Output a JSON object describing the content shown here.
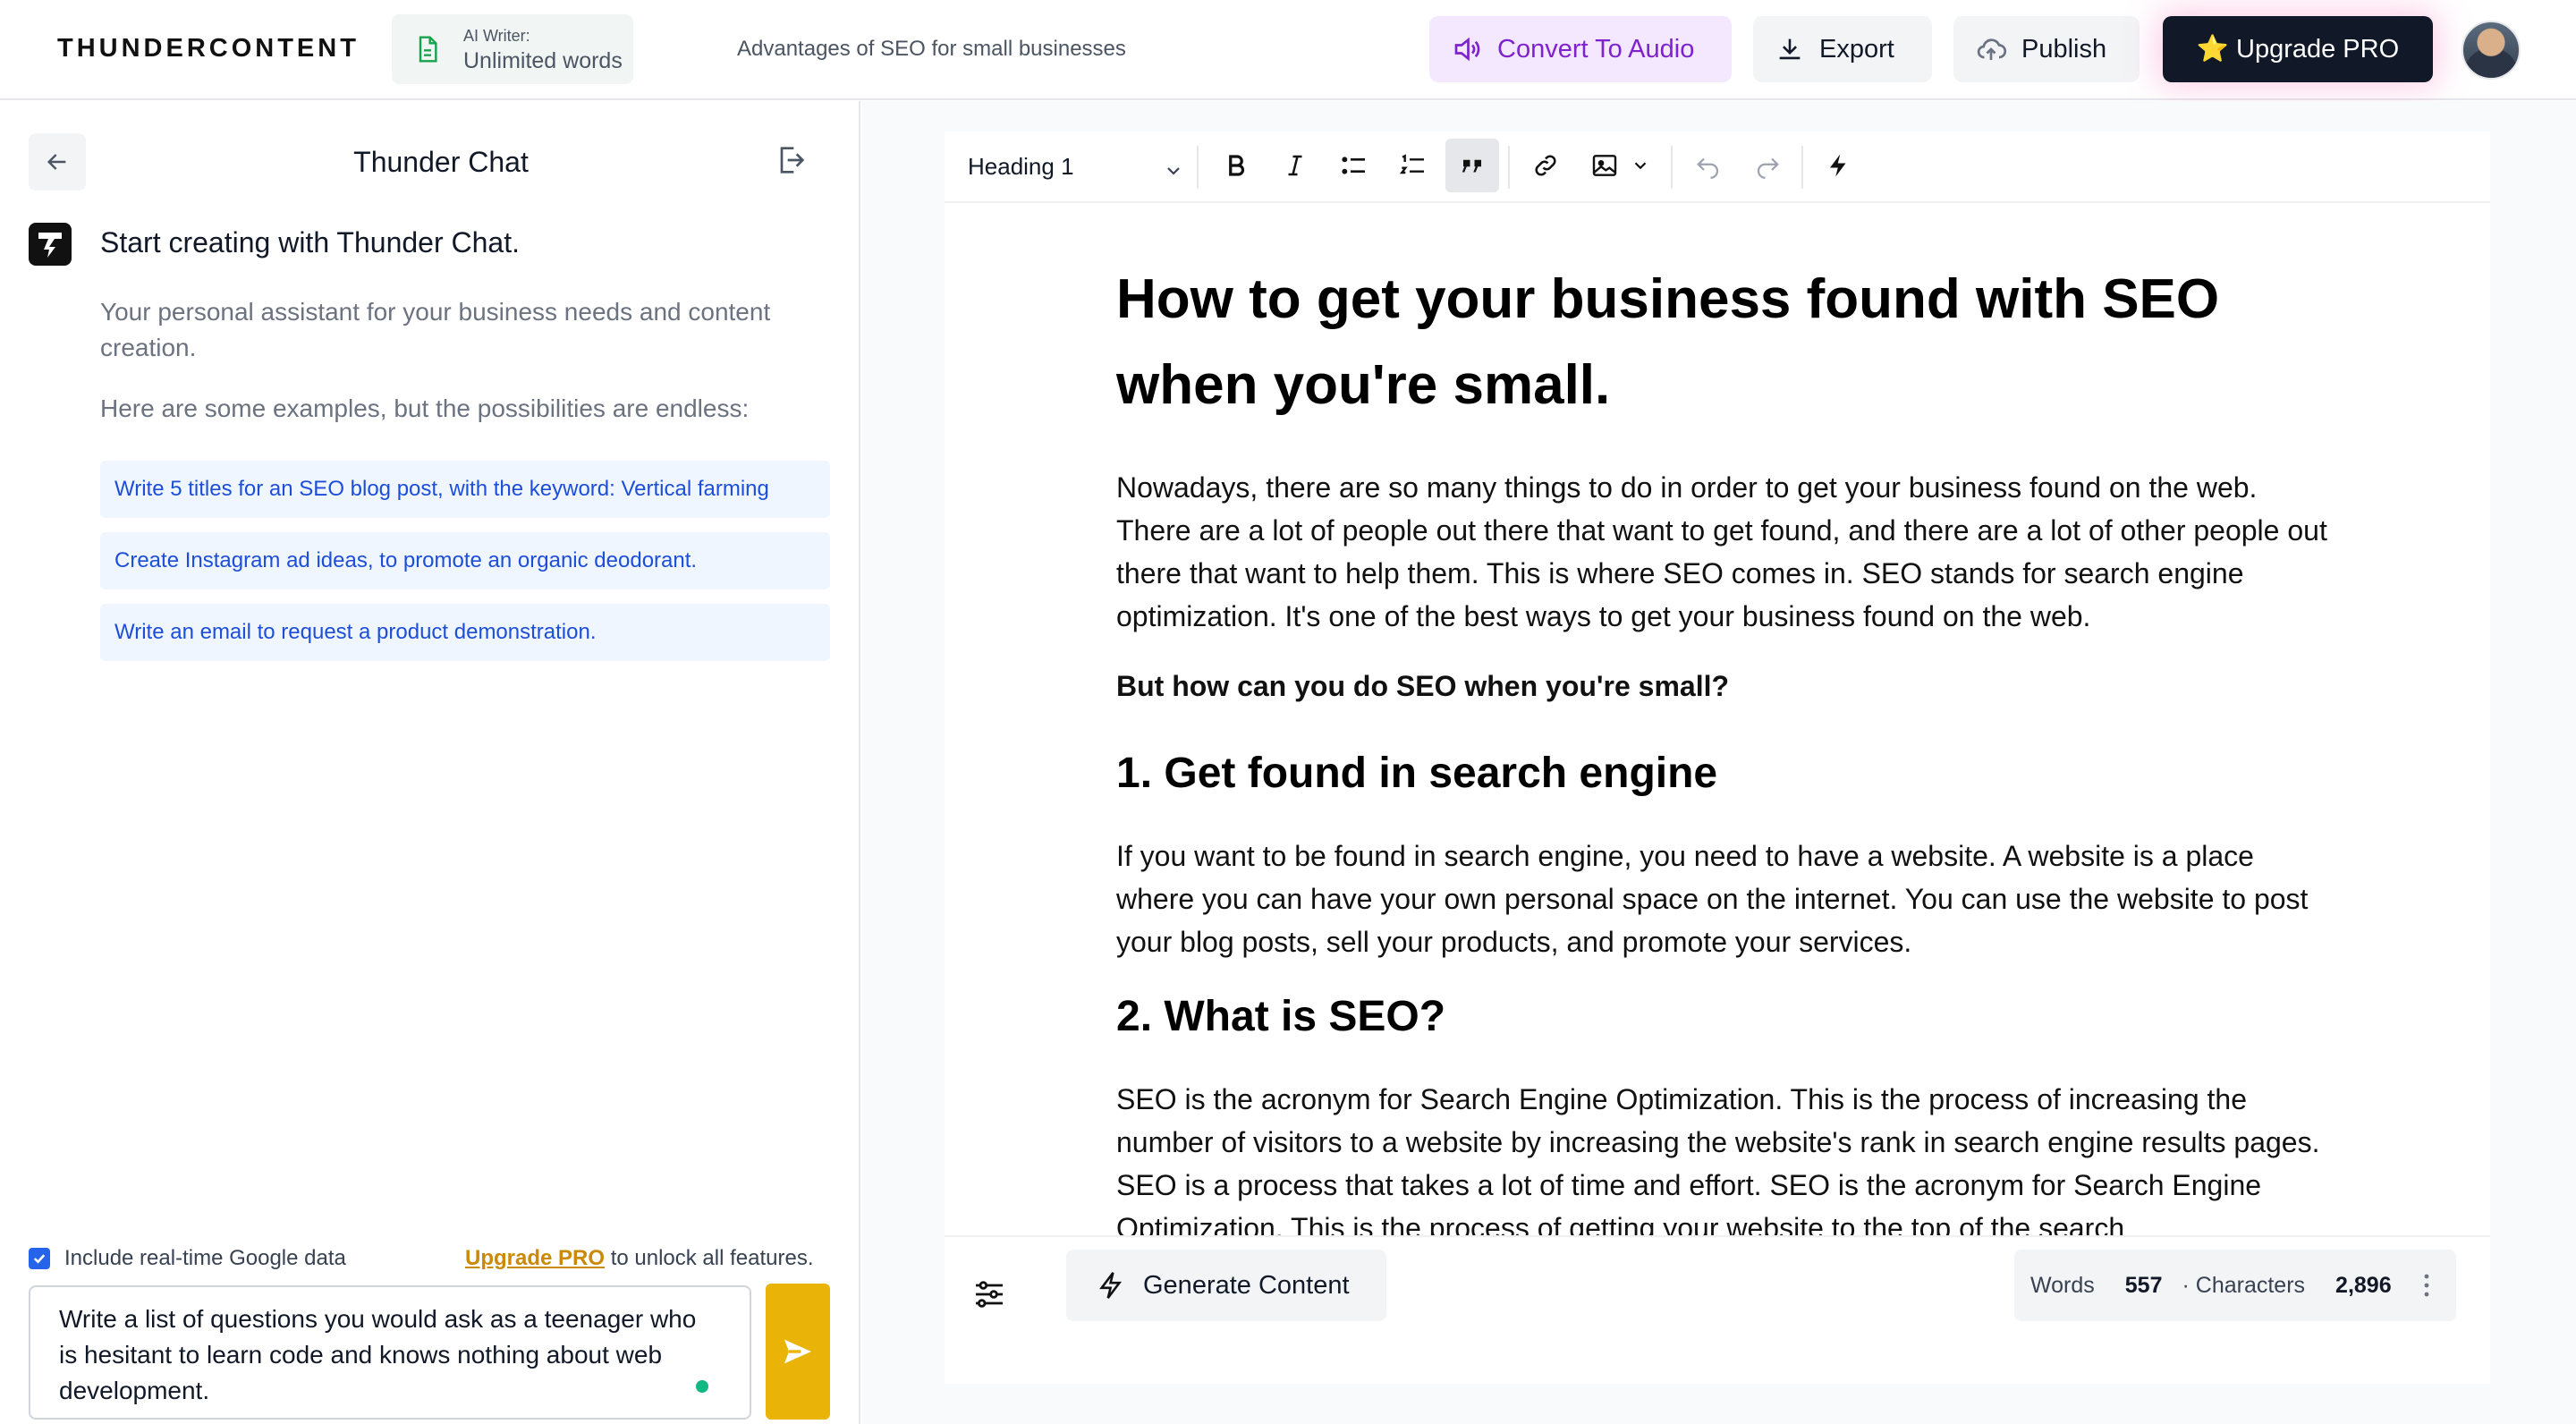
{
  "app": {
    "brand": "THUNDERCONTENT",
    "ai_writer_label": "AI Writer:",
    "ai_writer_value": "Unlimited words",
    "document_title": "Advantages of SEO for small businesses"
  },
  "header": {
    "convert_audio": "Convert To Audio",
    "export": "Export",
    "publish": "Publish",
    "upgrade": "⭐ Upgrade PRO"
  },
  "chat": {
    "title": "Thunder Chat",
    "start": "Start creating with Thunder Chat.",
    "description": "Your personal assistant for your business needs and content creation.",
    "examples_heading": "Here are some examples, but the possibilities are endless:",
    "examples": [
      "Write 5 titles for an SEO blog post, with the keyword: Vertical farming",
      "Create Instagram ad ideas, to promote an organic deodorant.",
      "Write an email to request a product demonstration."
    ],
    "include_google": "Include real-time Google data",
    "upgrade_link": "Upgrade PRO",
    "upgrade_suffix": " to unlock all features.",
    "input_value": "Write a list of questions you would ask as a teenager who is hesitant to learn code and knows nothing about web development."
  },
  "editor": {
    "heading_select": "Heading 1",
    "h1": "How to get your business found with SEO when you're small.",
    "p1": "Nowadays, there are so many things to do in order to get your business found on the web. There are a lot of people out there that want to get found, and there are a lot of other people out there that want to help them. This is where SEO comes in. SEO stands for search engine optimization. It's one of the best ways to get your business found on the web.",
    "p2": "But how can you do SEO when you're small?",
    "h2a": "1. Get found in search engine",
    "p3": " If you want to be found in search engine, you need to have a website. A website is a place where you can have your own personal space on the internet. You can use the website to post your blog posts, sell your products, and promote your services.",
    "h2b": "2. What is SEO?",
    "p4": " SEO is the acronym for Search Engine Optimization. This is the process of increasing the number of visitors to a website by increasing the website's rank in search engine results pages. SEO is a process that takes a lot of time and effort. SEO is the acronym for Search Engine Optimization. This is the process of getting your website to the top of the search"
  },
  "footer": {
    "generate": "Generate Content",
    "words_label": "Words",
    "words_value": "557",
    "chars_label": "· Characters",
    "chars_value": "2,896"
  },
  "colors": {
    "accent_purple": "#7e22ce",
    "upgrade_dark": "#111827",
    "send_yellow": "#eab308",
    "link_blue": "#1d4ed8"
  }
}
